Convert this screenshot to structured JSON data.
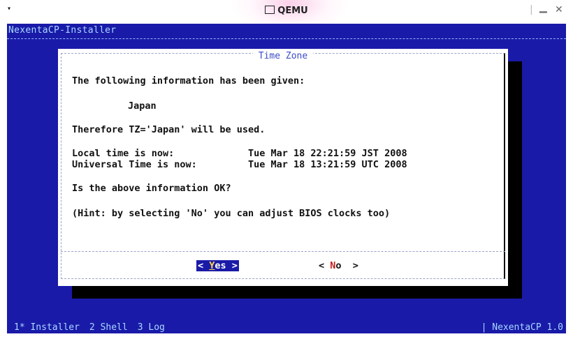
{
  "window": {
    "title": "QEMU",
    "menu_glyph": "▾",
    "minimize_glyph": "▁",
    "close_glyph": "✕"
  },
  "terminal": {
    "header": "NexentaCP-Installer",
    "colors": {
      "background": "#1a1aa8",
      "dialog": "#ffffff",
      "shadow": "#000000"
    }
  },
  "dialog": {
    "title": "Time Zone",
    "lines": {
      "intro": "The following information has been given:",
      "country": "Japan",
      "tz": "Therefore TZ='Japan' will be used.",
      "local_label": "Local time is now:",
      "local_value": "Tue Mar 18 22:21:59 JST 2008",
      "utc_label": "Universal Time is now:",
      "utc_value": "Tue Mar 18 13:21:59 UTC 2008",
      "question": "Is the above information OK?",
      "hint": "(Hint: by selecting 'No' you can adjust BIOS clocks too)"
    },
    "buttons": {
      "yes_pre": "< ",
      "yes_hot": "Y",
      "yes_post": "es >",
      "no_pre": "< ",
      "no_hot": "N",
      "no_post": "o  >"
    }
  },
  "statusbar": {
    "tabs": [
      "1* Installer",
      "2 Shell",
      "3 Log"
    ],
    "brand": "| NexentaCP 1.0"
  }
}
